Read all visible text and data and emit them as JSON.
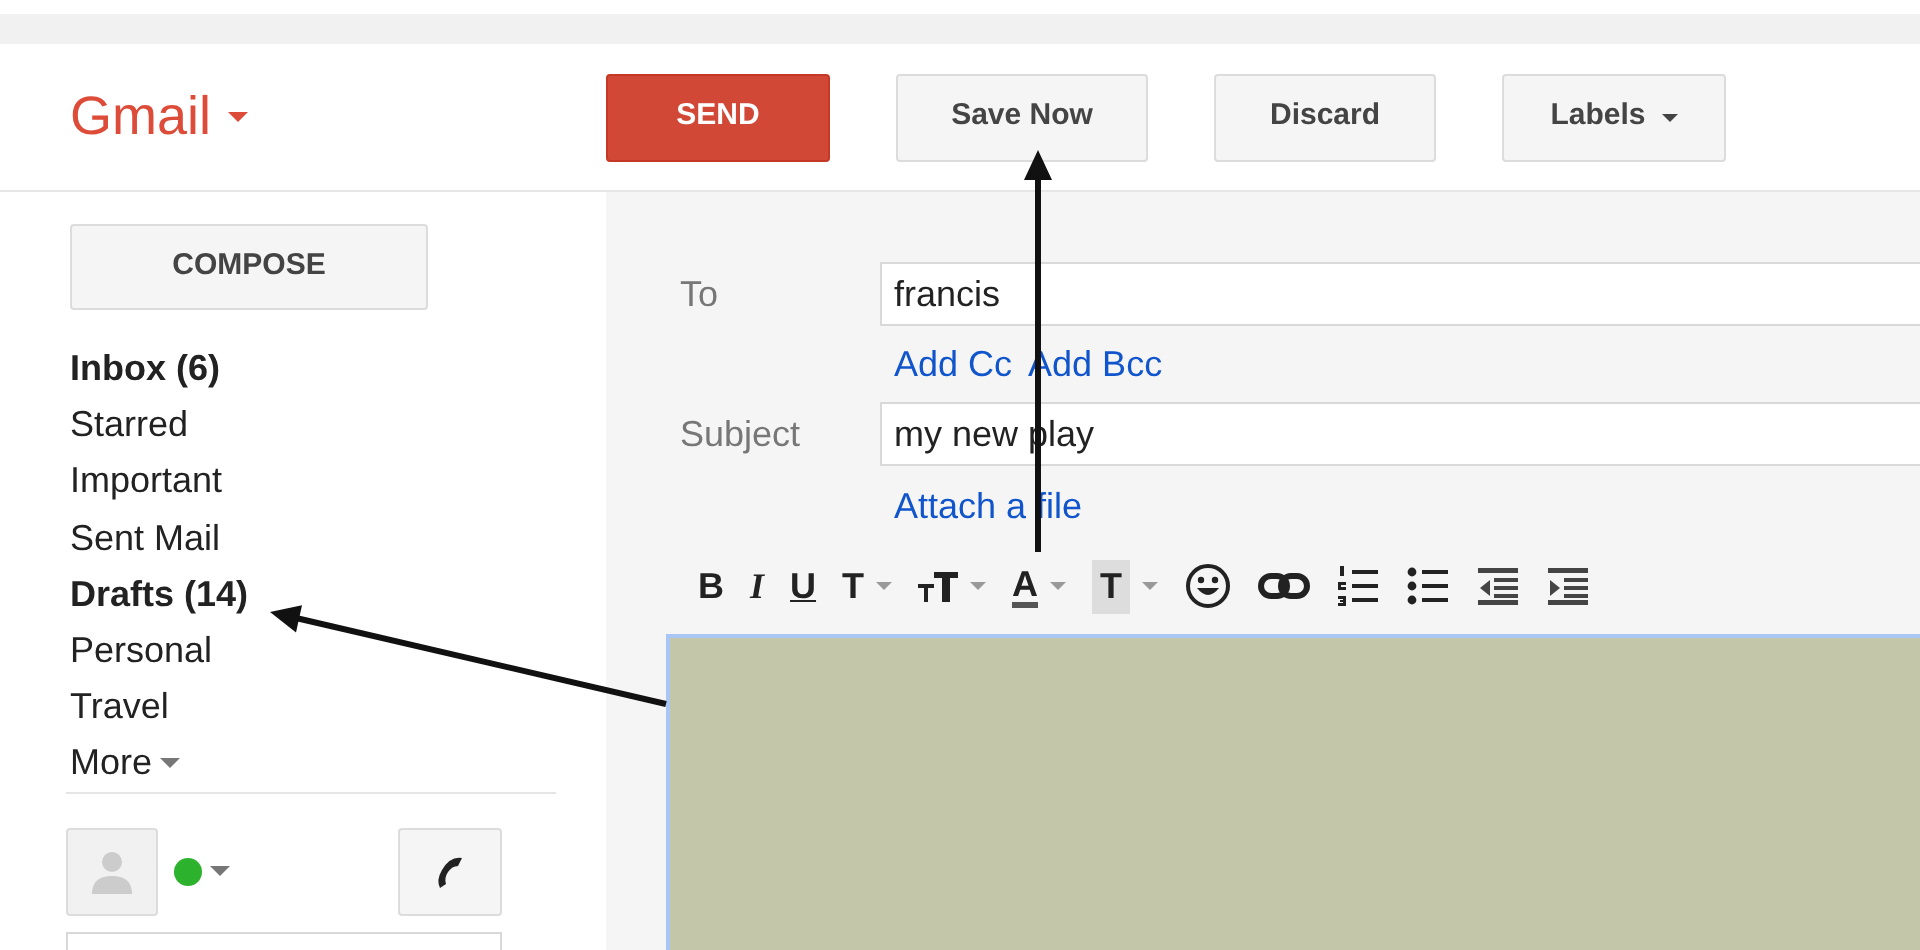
{
  "brand": "Gmail",
  "actions": [
    {
      "label": "SEND",
      "kind": "primary"
    },
    {
      "label": "Save Now",
      "kind": "plain"
    },
    {
      "label": "Discard",
      "kind": "plain"
    },
    {
      "label": "Labels",
      "kind": "menu"
    }
  ],
  "compose": "COMPOSE",
  "folders": [
    {
      "label": "Inbox (6)",
      "unread": true
    },
    {
      "label": "Starred",
      "unread": false
    },
    {
      "label": "Important",
      "unread": false
    },
    {
      "label": "Sent Mail",
      "unread": false
    },
    {
      "label": "Drafts (14)",
      "unread": true
    },
    {
      "label": "Personal",
      "unread": false
    },
    {
      "label": "Travel",
      "unread": false
    }
  ],
  "more": "More",
  "chat": {
    "online": true
  },
  "message": {
    "to_label": "To",
    "to": "francis",
    "cc_link": "Add Cc",
    "bcc_link": "Add Bcc",
    "subject_label": "Subject",
    "subject": "my new play",
    "attach": "Attach a file"
  },
  "toolbar": [
    {
      "kind": "bold",
      "label": "B",
      "dropdown": false
    },
    {
      "kind": "italic",
      "label": "I",
      "dropdown": false
    },
    {
      "kind": "underline",
      "label": "U",
      "dropdown": false
    },
    {
      "kind": "font",
      "label": "T",
      "dropdown": true
    },
    {
      "kind": "size",
      "dropdown": true
    },
    {
      "kind": "color",
      "label": "A",
      "dropdown": true
    },
    {
      "kind": "highlight",
      "label": "T",
      "dropdown": true
    },
    {
      "kind": "emoji",
      "dropdown": false
    },
    {
      "kind": "link",
      "dropdown": false
    },
    {
      "kind": "numbered",
      "dropdown": false
    },
    {
      "kind": "bulleted",
      "dropdown": false
    },
    {
      "kind": "outdent",
      "dropdown": false
    },
    {
      "kind": "indent",
      "dropdown": false
    }
  ]
}
